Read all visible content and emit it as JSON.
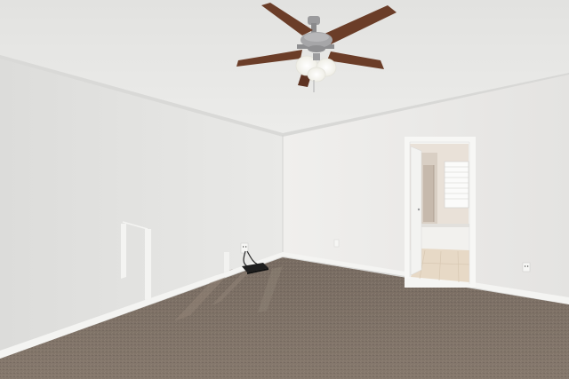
{
  "scene": {
    "icons": {
      "ceiling_fan": "ceiling-fan-icon",
      "light_bulb": "light-bulb-icon",
      "power_outlet": "power-outlet-icon",
      "router": "router-icon",
      "window": "window-icon"
    },
    "colors": {
      "ceiling": "#e6e6e4",
      "left_wall": "#e1e1df",
      "right_wall": "#ecebe9",
      "carpet": "#7e7166",
      "carpet_dark": "#6f6359",
      "baseboard": "#f4f4f2",
      "fan_blade": "#6b3d28",
      "fan_metal": "#9a9a9c",
      "bathroom_floor": "#e7d9c6",
      "bathroom_wall": "#e9e1d8",
      "door": "#f3f3f1",
      "light_glass": "#fbfaf4"
    }
  }
}
